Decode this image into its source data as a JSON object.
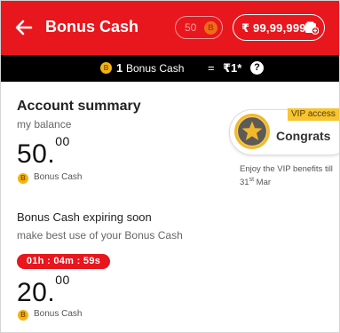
{
  "header": {
    "title": "Bonus Cash",
    "coin_count": "50",
    "coin_letter": "B",
    "wallet_balance": "₹ 99,99,999"
  },
  "info_bar": {
    "coin_letter": "B",
    "count": "1",
    "label": "Bonus Cash",
    "equals": "=",
    "value": "₹1*",
    "help": "?"
  },
  "account_summary": {
    "title": "Account summary",
    "subtitle": "my balance",
    "amount_int": "50.",
    "amount_dec": "00",
    "currency_label": "Bonus Cash",
    "coin_letter": "B"
  },
  "vip": {
    "tag": "VIP access",
    "headline": "Congrats",
    "note_prefix": "Enjoy the VIP benefits till 31",
    "note_suffix_sup": "st",
    "note_month": " Mar"
  },
  "expiring": {
    "title": "Bonus Cash expiring soon",
    "subtitle": "make best use of your Bonus Cash",
    "timer": "01h : 04m : 59s",
    "amount_int": "20.",
    "amount_dec": "00",
    "currency_label": "Bonus Cash",
    "coin_letter": "B"
  },
  "colors": {
    "brand_red": "#e8161d",
    "coin_gold": "#f5b40f",
    "vip_gold": "#f7c531"
  }
}
